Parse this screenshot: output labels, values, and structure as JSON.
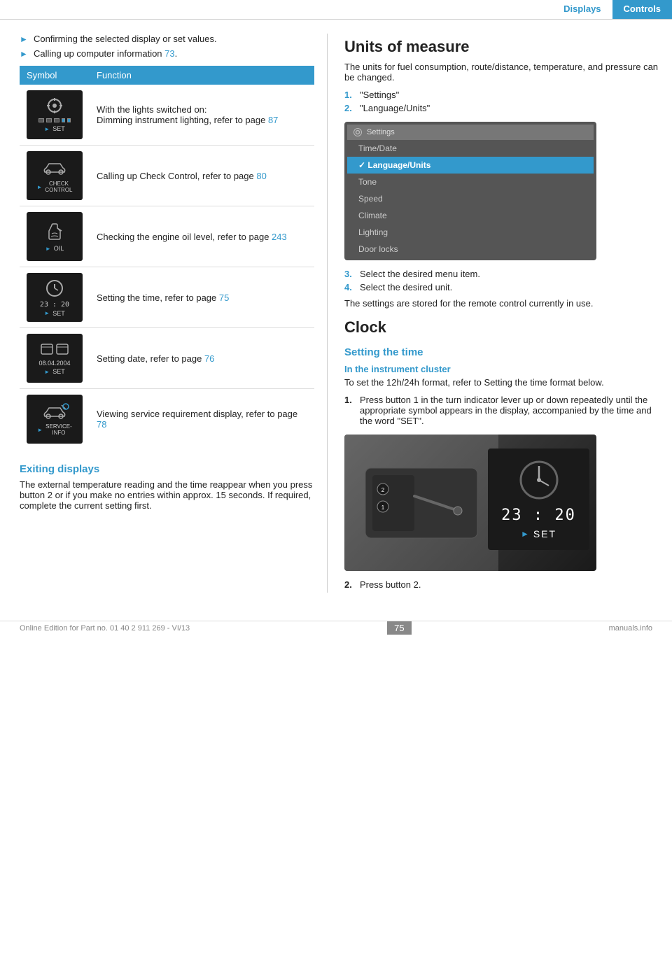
{
  "header": {
    "displays_label": "Displays",
    "controls_label": "Controls"
  },
  "left_col": {
    "bullet_items": [
      {
        "text": "Confirming the selected display or set values."
      },
      {
        "text": "Calling up computer information",
        "link": "73",
        "after": "."
      }
    ],
    "table": {
      "col1_header": "Symbol",
      "col2_header": "Function",
      "rows": [
        {
          "symbol_label": "SET",
          "symbol_type": "lights",
          "description_lines": [
            "With the lights switched on:",
            "Dimming instrument lighting, refer to page 87"
          ],
          "link_page": "87"
        },
        {
          "symbol_type": "car",
          "description": "Calling up Check Control, refer to page 80",
          "label_line1": "CHECK",
          "label_line2": "CONTROL",
          "link_page": "80"
        },
        {
          "symbol_type": "oil",
          "description": "Checking the engine oil level, refer to page 243",
          "label": "OIL",
          "link_page": "243"
        },
        {
          "symbol_type": "clock",
          "description": "Setting the time, refer to page 75",
          "time_display": "23 : 20",
          "label": "SET",
          "link_page": "75"
        },
        {
          "symbol_type": "date",
          "description": "Setting date, refer to page 76",
          "date_display": "08.04.2004",
          "label": "SET",
          "link_page": "76"
        },
        {
          "symbol_type": "service",
          "description": "Viewing service requirement display, refer to page 78",
          "label_line1": "SERVICE-",
          "label_line2": "INFO",
          "link_page": "78"
        }
      ]
    },
    "exiting_section": {
      "heading": "Exiting displays",
      "body": "The external temperature reading and the time reappear when you press button 2 or if you make no entries within approx. 15 seconds. If required, complete the current setting first."
    }
  },
  "right_col": {
    "units_section": {
      "heading": "Units of measure",
      "intro": "The units for fuel consumption, route/distance, temperature, and pressure can be changed.",
      "steps": [
        {
          "num": "1.",
          "text": "\"Settings\""
        },
        {
          "num": "2.",
          "text": "\"Language/Units\""
        }
      ],
      "settings_menu": {
        "title": "Settings",
        "items": [
          {
            "label": "Time/Date",
            "selected": false
          },
          {
            "label": "Language/Units",
            "selected": true
          },
          {
            "label": "Tone",
            "selected": false
          },
          {
            "label": "Speed",
            "selected": false
          },
          {
            "label": "Climate",
            "selected": false
          },
          {
            "label": "Lighting",
            "selected": false
          },
          {
            "label": "Door locks",
            "selected": false
          }
        ]
      },
      "steps_after": [
        {
          "num": "3.",
          "color": "blue",
          "text": "Select the desired menu item."
        },
        {
          "num": "4.",
          "color": "blue",
          "text": "Select the desired unit."
        }
      ],
      "footer_text": "The settings are stored for the remote control currently in use."
    },
    "clock_section": {
      "heading": "Clock",
      "setting_time_heading": "Setting the time",
      "instrument_cluster_heading": "In the instrument cluster",
      "intro": "To set the 12h/24h format, refer to Setting the time format below.",
      "steps": [
        {
          "num": "1.",
          "color": "black",
          "text": "Press button 1 in the turn indicator lever up or down repeatedly until the appropriate symbol appears in the display, accompanied by the time and the word \"SET\"."
        }
      ],
      "car_image": {
        "time_display": "23 : 20",
        "set_label": "SET"
      },
      "steps_after": [
        {
          "num": "2.",
          "color": "black",
          "text": "Press button 2."
        }
      ]
    }
  },
  "footer": {
    "edition_text": "Online Edition for Part no. 01 40 2 911 269 - VI/13",
    "page_number": "75",
    "site": "manuals.info"
  }
}
